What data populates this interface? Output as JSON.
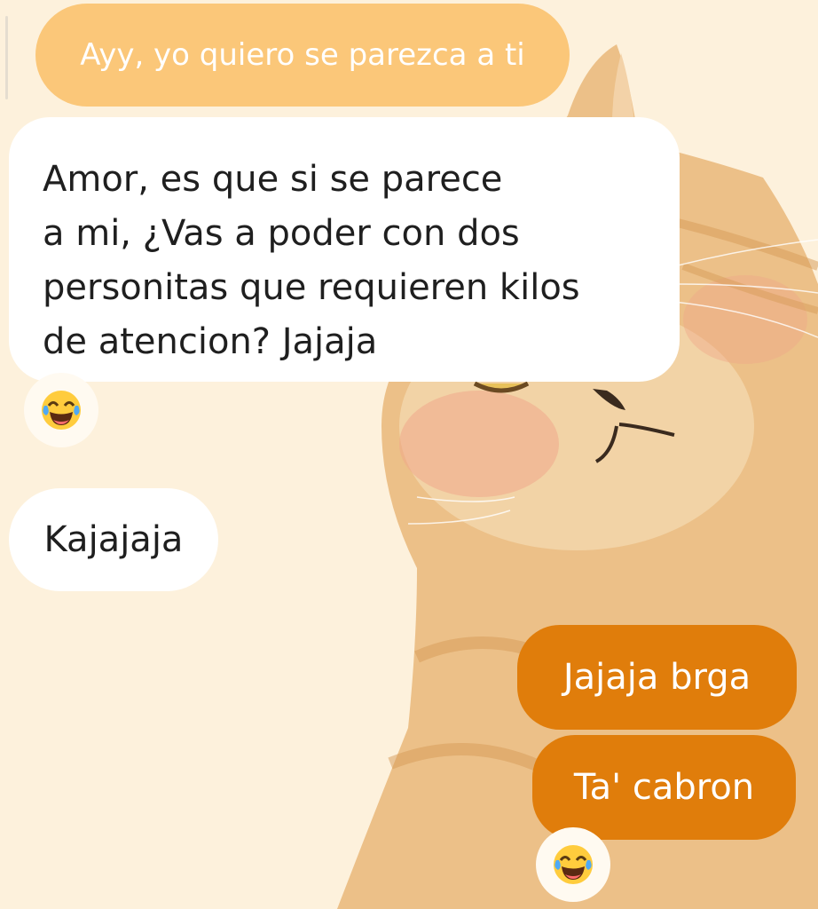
{
  "chat": {
    "quoted_message": "Ayy, yo quiero se parezca a ti",
    "incoming_long": [
      "Amor, es que si se parece",
      "a mi, ¿Vas a poder con dos",
      "personitas que requieren kilos",
      "de atencion? Jajaja"
    ],
    "incoming_short": "Kajajaja",
    "outgoing": [
      "Jajaja brga",
      "Ta' cabron"
    ],
    "reactions": [
      {
        "icon": "tears-of-joy-emoji",
        "on": "incoming_long"
      },
      {
        "icon": "tears-of-joy-emoji",
        "on": "outgoing_last"
      }
    ]
  },
  "colors": {
    "background": "#fdf1dc",
    "quoted_bubble": "#fbc779",
    "incoming_bubble": "#ffffff",
    "outgoing_bubble": "#e07d0b",
    "wallpaper_cat": "#e9b877"
  },
  "wallpaper": "orange-tabby-cat-illustration"
}
